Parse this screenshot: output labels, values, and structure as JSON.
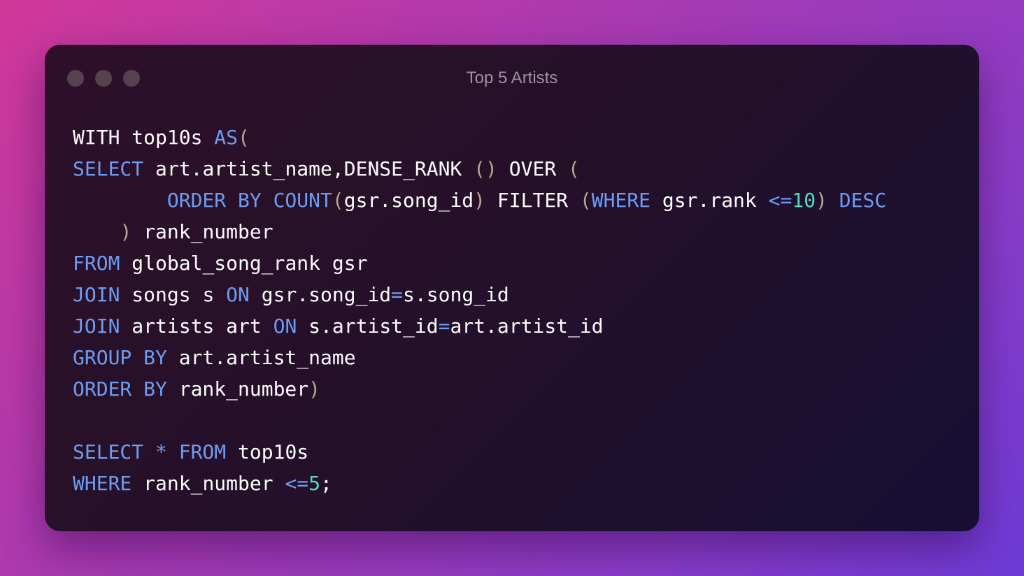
{
  "window": {
    "title": "Top 5 Artists",
    "controls": [
      "close",
      "minimize",
      "maximize"
    ]
  },
  "colors": {
    "keyword": "#6d9df2",
    "number": "#4fdfbd",
    "paren": "#b5a88c",
    "text": "#ffffff",
    "title": "#9d929f"
  },
  "code": {
    "lines": [
      [
        {
          "t": "WITH top10s ",
          "c": "plain"
        },
        {
          "t": "AS",
          "c": "kw"
        },
        {
          "t": "(",
          "c": "paren"
        }
      ],
      [
        {
          "t": "SELECT",
          "c": "kw"
        },
        {
          "t": " art.artist_name,DENSE_RANK ",
          "c": "plain"
        },
        {
          "t": "()",
          "c": "paren"
        },
        {
          "t": " OVER ",
          "c": "plain"
        },
        {
          "t": "(",
          "c": "paren"
        }
      ],
      [
        {
          "t": "        ",
          "c": "plain"
        },
        {
          "t": "ORDER BY COUNT",
          "c": "kw"
        },
        {
          "t": "(",
          "c": "paren"
        },
        {
          "t": "gsr.song_id",
          "c": "plain"
        },
        {
          "t": ")",
          "c": "paren"
        },
        {
          "t": " FILTER ",
          "c": "plain"
        },
        {
          "t": "(",
          "c": "paren"
        },
        {
          "t": "WHERE",
          "c": "kw"
        },
        {
          "t": " gsr.rank ",
          "c": "plain"
        },
        {
          "t": "<=",
          "c": "kw"
        },
        {
          "t": "10",
          "c": "num"
        },
        {
          "t": ")",
          "c": "paren"
        },
        {
          "t": " ",
          "c": "plain"
        },
        {
          "t": "DESC",
          "c": "kw"
        }
      ],
      [
        {
          "t": "    ",
          "c": "plain"
        },
        {
          "t": ")",
          "c": "paren"
        },
        {
          "t": " rank_number",
          "c": "plain"
        }
      ],
      [
        {
          "t": "FROM",
          "c": "kw"
        },
        {
          "t": " global_song_rank gsr",
          "c": "plain"
        }
      ],
      [
        {
          "t": "JOIN",
          "c": "kw"
        },
        {
          "t": " songs s ",
          "c": "plain"
        },
        {
          "t": "ON",
          "c": "kw"
        },
        {
          "t": " gsr.song_id",
          "c": "plain"
        },
        {
          "t": "=",
          "c": "kw"
        },
        {
          "t": "s.song_id",
          "c": "plain"
        }
      ],
      [
        {
          "t": "JOIN",
          "c": "kw"
        },
        {
          "t": " artists art ",
          "c": "plain"
        },
        {
          "t": "ON",
          "c": "kw"
        },
        {
          "t": " s.artist_id",
          "c": "plain"
        },
        {
          "t": "=",
          "c": "kw"
        },
        {
          "t": "art.artist_id",
          "c": "plain"
        }
      ],
      [
        {
          "t": "GROUP BY",
          "c": "kw"
        },
        {
          "t": " art.artist_name",
          "c": "plain"
        }
      ],
      [
        {
          "t": "ORDER BY",
          "c": "kw"
        },
        {
          "t": " rank_number",
          "c": "plain"
        },
        {
          "t": ")",
          "c": "paren"
        }
      ],
      [],
      [
        {
          "t": "SELECT * FROM",
          "c": "kw"
        },
        {
          "t": " top10s",
          "c": "plain"
        }
      ],
      [
        {
          "t": "WHERE",
          "c": "kw"
        },
        {
          "t": " rank_number ",
          "c": "plain"
        },
        {
          "t": "<=",
          "c": "kw"
        },
        {
          "t": "5",
          "c": "num"
        },
        {
          "t": ";",
          "c": "plain"
        }
      ]
    ]
  }
}
